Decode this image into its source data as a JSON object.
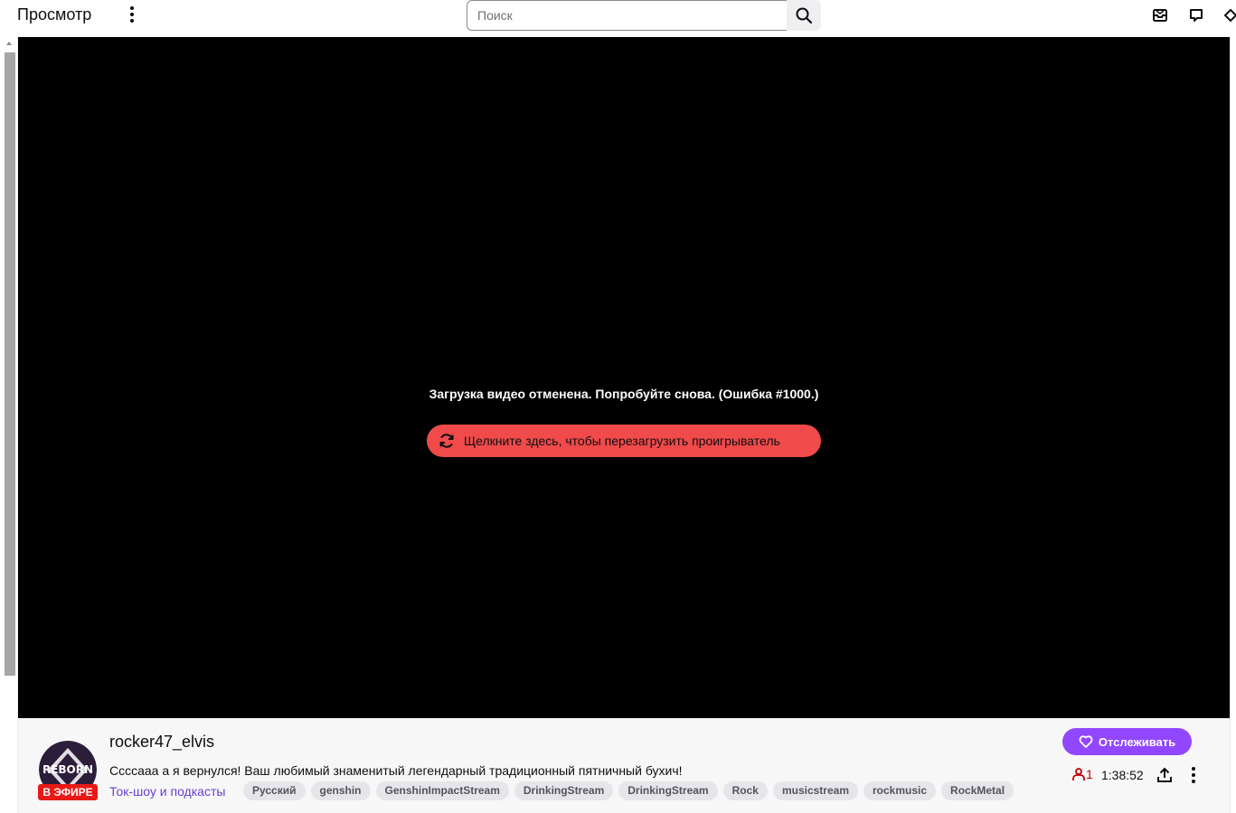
{
  "topbar": {
    "browse_label": "Просмотр",
    "more_icon": "more-vertical-icon",
    "search": {
      "placeholder": "Поиск",
      "value": ""
    },
    "search_icon": "search-icon",
    "icons": [
      "inbox-icon",
      "whispers-icon",
      "prime-crown-icon"
    ]
  },
  "player": {
    "error_message": "Загрузка видео отменена. Попробуйте снова. (Ошибка #1000.)",
    "reload_label": "Щелкните здесь, чтобы перезагрузить проигрыватель",
    "reload_icon": "refresh-icon",
    "reload_color": "#f04a4a"
  },
  "stream": {
    "avatar_label": "REBORN",
    "live_label": "В ЭФИРЕ",
    "channel_name": "rocker47_elvis",
    "title": "Ссссааа а я вернулся! Ваш любимый знаменитый легендарный традиционный пятничный бухич!",
    "category": "Ток-шоу и подкасты",
    "tags": [
      "Русский",
      "genshin",
      "GenshinImpactStream",
      "DrinkingStream",
      "DrinkingStream",
      "Rock",
      "musicstream",
      "rockmusic",
      "RockMetal"
    ],
    "follow_label": "Отслеживать",
    "follow_color": "#9147ff",
    "viewers": "1",
    "uptime": "1:38:52",
    "live_color": "#e91916"
  }
}
